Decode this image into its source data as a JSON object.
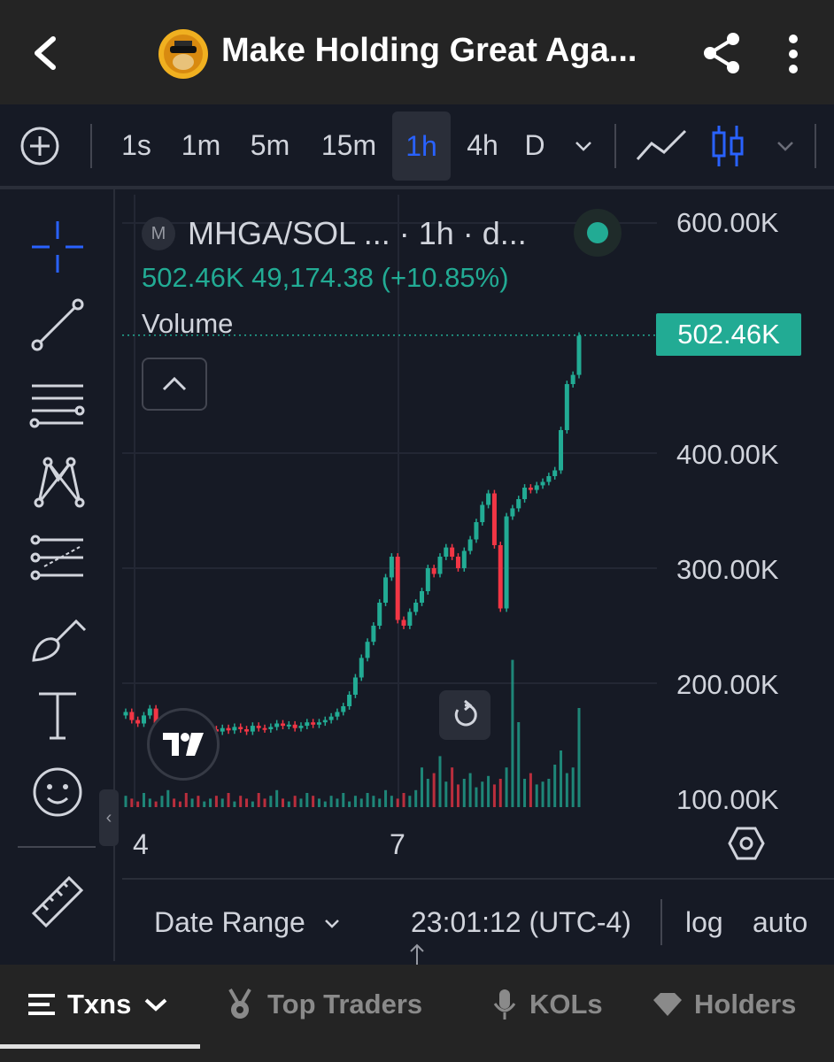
{
  "header": {
    "title": "Make Holding Great Aga...",
    "back_icon": "chevron-left-icon",
    "share_icon": "share-icon",
    "more_icon": "more-vertical-icon"
  },
  "toolbar": {
    "add_icon": "plus-circle-icon",
    "intervals": [
      "1s",
      "1m",
      "5m",
      "15m",
      "1h",
      "4h",
      "D"
    ],
    "active_interval": "1h",
    "line_icon": "line-chart-icon",
    "candle_icon": "candlestick-icon"
  },
  "left_tools": [
    "crosshair-icon",
    "trend-line-icon",
    "horizontal-lines-icon",
    "pattern-icon",
    "fib-icon",
    "brush-icon",
    "text-icon",
    "emoji-icon",
    "ruler-icon"
  ],
  "chart": {
    "badge": "M",
    "symbol_line": "MHGA/SOL ... · 1h · d...",
    "legend_values": "502.46K  49,174.38 (+10.85%)",
    "volume_label": "Volume",
    "price_tag": "502.46K",
    "y_ticks": [
      "600.00K",
      "400.00K",
      "300.00K",
      "200.00K",
      "100.00K"
    ],
    "x_ticks": [
      "4",
      "7"
    ],
    "colors": {
      "up": "#22ab94",
      "down": "#f23645"
    }
  },
  "chart_data": {
    "type": "candlestick",
    "title": "",
    "ylabel": "",
    "xlabel": "",
    "ylim": [
      100000,
      600000
    ],
    "x_ticks": [
      "4",
      "7"
    ],
    "last_price": 502460,
    "series": [
      {
        "name": "Volume",
        "values": [
          4,
          3,
          2,
          5,
          3,
          2,
          4,
          6,
          3,
          2,
          5,
          3,
          4,
          2,
          3,
          4,
          3,
          5,
          2,
          4,
          3,
          2,
          5,
          3,
          4,
          6,
          3,
          2,
          4,
          3,
          5,
          4,
          3,
          2,
          4,
          3,
          5,
          2,
          4,
          3,
          5,
          4,
          3,
          6,
          4,
          3,
          5,
          4,
          6,
          14,
          10,
          12,
          18,
          9,
          14,
          8,
          10,
          12,
          7,
          9,
          11,
          8,
          10,
          14,
          52,
          30,
          10,
          12,
          8,
          9,
          10,
          15,
          20,
          12,
          14,
          35
        ]
      }
    ],
    "close_values": [
      175,
      168,
      165,
      172,
      178,
      160,
      162,
      166,
      164,
      158,
      150,
      152,
      149,
      155,
      160,
      158,
      161,
      159,
      162,
      160,
      158,
      163,
      161,
      160,
      162,
      165,
      163,
      164,
      161,
      163,
      166,
      164,
      166,
      168,
      171,
      175,
      180,
      190,
      205,
      222,
      236,
      250,
      270,
      292,
      310,
      255,
      250,
      262,
      270,
      280,
      300,
      295,
      310,
      318,
      310,
      300,
      315,
      325,
      340,
      355,
      365,
      320,
      265,
      345,
      352,
      360,
      370,
      368,
      372,
      375,
      380,
      385,
      420,
      460,
      468,
      502
    ]
  },
  "bottom_bar": {
    "date_range": "Date Range",
    "time": "23:01:12 (UTC-4)",
    "log": "log",
    "auto": "auto"
  },
  "tabs": [
    {
      "label": "Txns",
      "icon": "list-icon"
    },
    {
      "label": "Top Traders",
      "icon": "medal-icon"
    },
    {
      "label": "KOLs",
      "icon": "microphone-icon"
    },
    {
      "label": "Holders",
      "icon": "diamond-icon"
    }
  ]
}
